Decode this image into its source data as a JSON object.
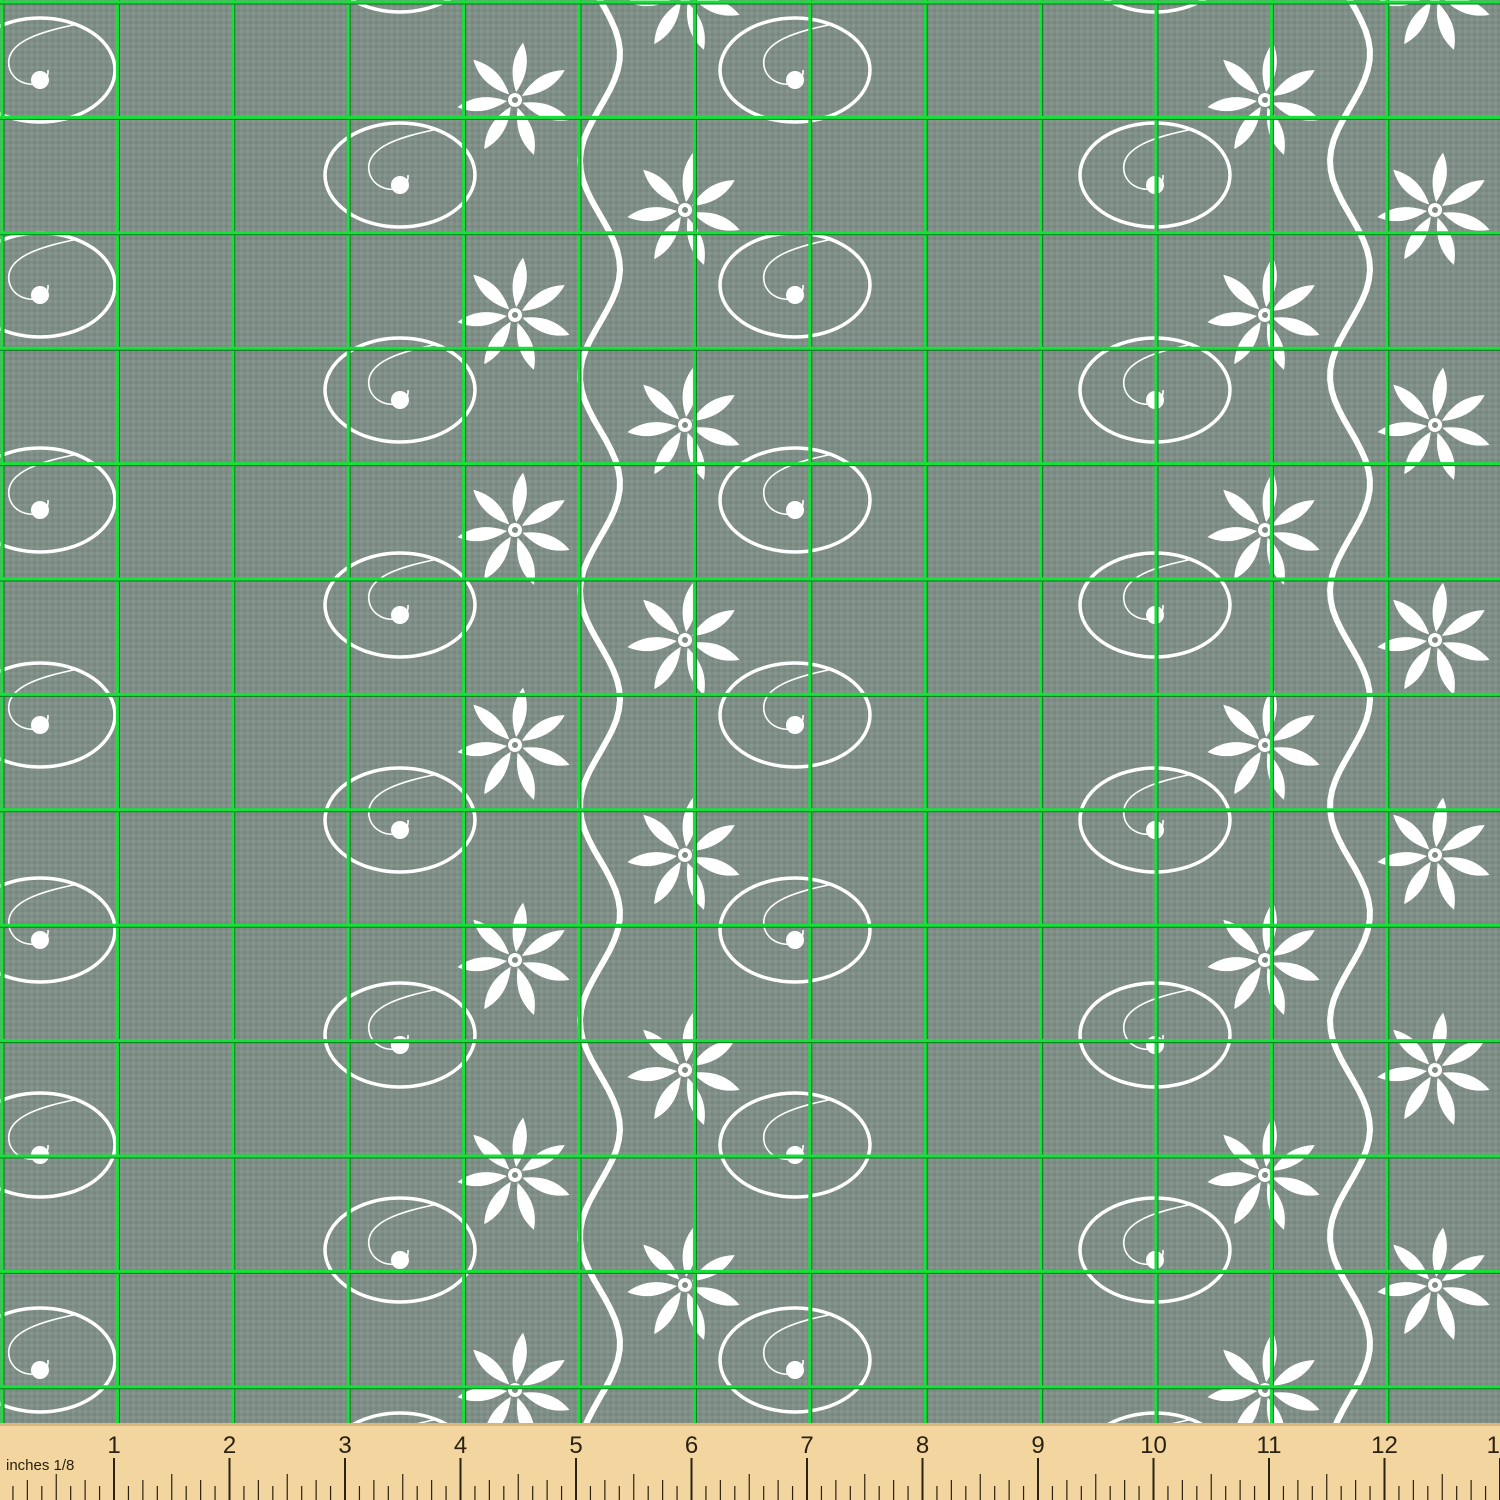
{
  "fabric": {
    "colors": {
      "background": "#7f8e86",
      "weave_dark": "#73827a",
      "weave_light": "#8c9b93",
      "motif": "#ffffff",
      "grid_line": "#18e03a",
      "grid_line_shadow": "#0a7a1c",
      "ruler_face": "#f3d69f",
      "ruler_edge": "#d9b77a",
      "ruler_ink": "#2a2110"
    },
    "motifs": [
      "daisy-flower",
      "spiral-swirl",
      "wavy-vine"
    ]
  },
  "ruler": {
    "unit_label": "inches 1/8",
    "numbers": [
      "1",
      "2",
      "3",
      "4",
      "5",
      "6",
      "7",
      "8",
      "9",
      "10",
      "11",
      "12",
      "13"
    ]
  }
}
